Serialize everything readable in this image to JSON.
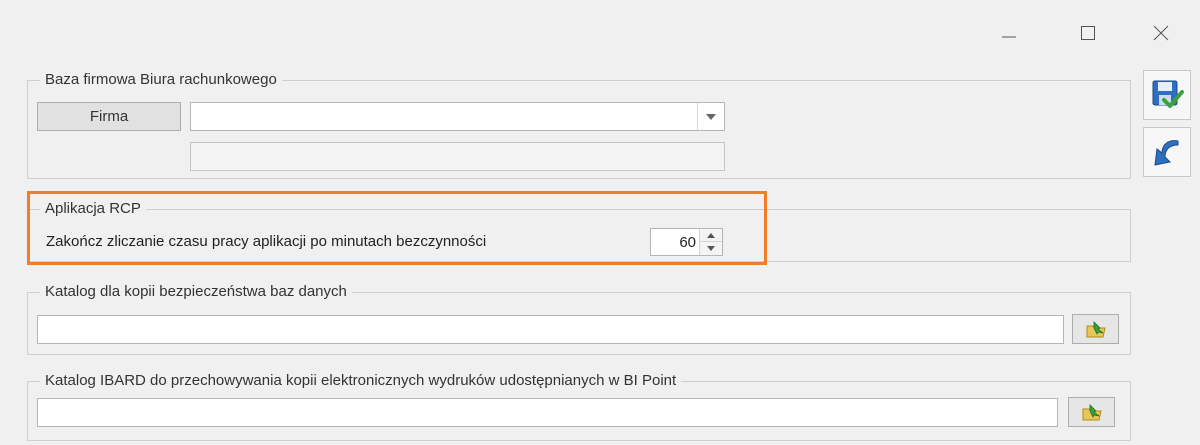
{
  "window": {
    "minimize_icon": "minimize-icon",
    "maximize_icon": "maximize-icon",
    "close_icon": "close-icon"
  },
  "group_firm": {
    "title": "Baza firmowa Biura rachunkowego",
    "firma_button": "Firma",
    "company_select_value": "",
    "company_name_value": ""
  },
  "group_rcp": {
    "title": "Aplikacja RCP",
    "idle_label": "Zakończ zliczanie czasu pracy aplikacji po minutach bezczynności",
    "idle_minutes": "60",
    "highlight_color": "#f07d2a"
  },
  "group_backup": {
    "title": "Katalog dla kopii bezpieczeństwa baz danych",
    "path_value": ""
  },
  "group_ibard": {
    "title": "Katalog IBARD do przechowywania kopii elektronicznych wydruków udostępnianych w BI Point",
    "path_value": ""
  },
  "side_buttons": {
    "save_icon": "save-icon",
    "undo_icon": "undo-icon"
  }
}
